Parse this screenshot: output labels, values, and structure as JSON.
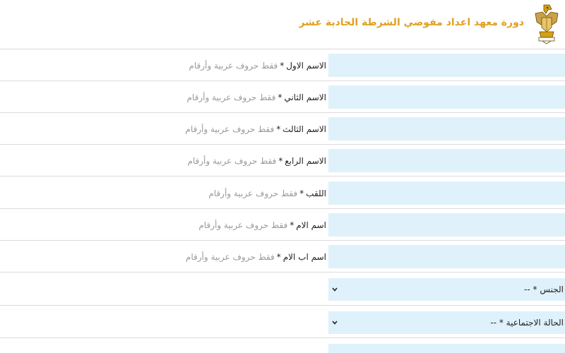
{
  "header": {
    "title": "دورة معهد اعداد مفوضي الشرطة الحادية عشر",
    "logo_icon": "eagle-emblem-icon"
  },
  "form": {
    "required_mark": "*",
    "fields": [
      {
        "label": "الاسم الاول",
        "hint": "فقط حروف عربية وأرقام",
        "value": ""
      },
      {
        "label": "الاسم الثاني",
        "hint": "فقط حروف عربية وأرقام",
        "value": ""
      },
      {
        "label": "الاسم الثالث",
        "hint": "فقط حروف عربية وأرقام",
        "value": ""
      },
      {
        "label": "الاسم الرابع",
        "hint": "فقط حروف عربية وأرقام",
        "value": ""
      },
      {
        "label": "اللقب",
        "hint": "فقط حروف عربية وأرقام",
        "value": ""
      },
      {
        "label": "اسم الام",
        "hint": "فقط حروف عربية وأرقام",
        "value": ""
      },
      {
        "label": "اسم اب الام",
        "hint": "فقط حروف عربية وأرقام",
        "value": ""
      }
    ],
    "selects": [
      {
        "selected": "الجنس * --"
      },
      {
        "selected": "الحالة الاجتماعية * --"
      }
    ]
  },
  "colors": {
    "accent": "#e0a020",
    "field_bg": "#dff1fb",
    "divider": "#dcdcdc"
  }
}
